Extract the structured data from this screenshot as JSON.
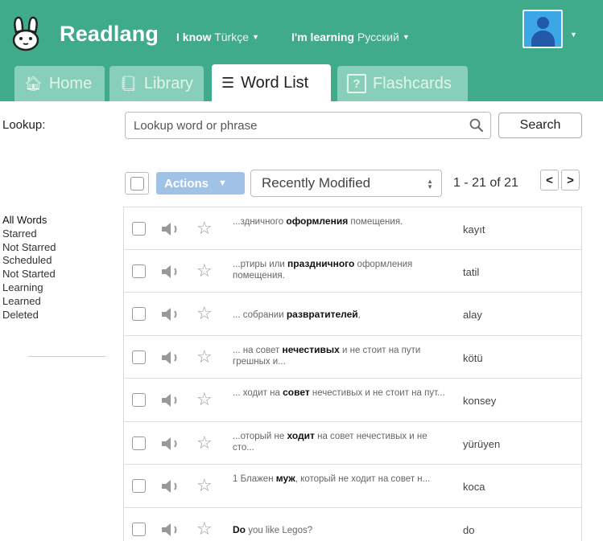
{
  "header": {
    "brand": "Readlang",
    "know_lead": "I know",
    "know_value": "Türkçe",
    "learn_lead": "I'm learning",
    "learn_value": "Русский"
  },
  "tabs": [
    {
      "label": "Home",
      "icon": "home-icon"
    },
    {
      "label": "Library",
      "icon": "book-icon"
    },
    {
      "label": "Word List",
      "icon": "list-icon",
      "active": true
    },
    {
      "label": "Flashcards",
      "icon": "question-icon"
    }
  ],
  "flashcards_glyph": "?",
  "lookup": {
    "label": "Lookup:",
    "placeholder": "Lookup word or phrase",
    "button": "Search"
  },
  "toolbar": {
    "actions": "Actions",
    "sort": "Recently Modified",
    "range": "1 - 21 of 21",
    "prev": "<",
    "next": ">"
  },
  "filters": [
    "All Words",
    "Starred",
    "Not Starred",
    "Scheduled",
    "Not Started",
    "Learning",
    "Learned",
    "Deleted"
  ],
  "words": [
    {
      "pre": "...здничного ",
      "bold": "оформления",
      "post": " помещения.",
      "translation": "kayıt"
    },
    {
      "pre": "...ртиры или ",
      "bold": "праздничного",
      "post": " оформления помещения.",
      "translation": "tatil"
    },
    {
      "pre": "... собрании ",
      "bold": "развратителей",
      "post": ",",
      "translation": "alay"
    },
    {
      "pre": "... на совет ",
      "bold": "нечестивых",
      "post": " и не стоит на пути грешных и...",
      "translation": "kötü"
    },
    {
      "pre": "... ходит на ",
      "bold": "совет",
      "post": " нечестивых и не стоит на пут...",
      "translation": "konsey"
    },
    {
      "pre": "...оторый не ",
      "bold": "ходит",
      "post": " на совет нечестивых и не сто...",
      "translation": "yürüyen"
    },
    {
      "pre": "1 Блажен ",
      "bold": "муж",
      "post": ", который не ходит на совет н...",
      "translation": "koca"
    },
    {
      "pre": "",
      "bold": "Do",
      "post": " you like Legos?",
      "translation": "do"
    }
  ],
  "colors": {
    "brand_green": "#3fab8a",
    "tab_inactive": "#87cfb8",
    "actions_blue": "#a0c2e6",
    "avatar_blue": "#3da7e6"
  }
}
